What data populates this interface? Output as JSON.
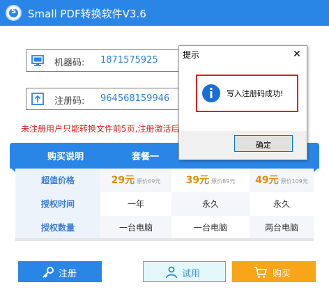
{
  "app": {
    "title": "Small PDF转换软件V3.6",
    "logo_letter": "S",
    "accent_color": "#2a86e6"
  },
  "fields": {
    "machine": {
      "label": "机器码:",
      "value": "1871575925",
      "icon": "monitor-icon"
    },
    "registration": {
      "label": "注册码:",
      "value": "964568159946",
      "icon": "upload-icon"
    }
  },
  "warning": "未注册用户只能转换文件前5页,注册激活后",
  "plans": {
    "header": {
      "desc": "购买说明",
      "plan1": "套餐一"
    },
    "rows": [
      {
        "label": "超值价格",
        "cells": [
          {
            "price": "29元",
            "original": "原价69元"
          },
          {
            "price": "39元",
            "original": "原价89元"
          },
          {
            "price": "49元",
            "original": "原价109元"
          }
        ]
      },
      {
        "label": "授权时间",
        "cells": [
          "一年",
          "永久",
          "永久"
        ]
      },
      {
        "label": "授权数量",
        "cells": [
          "一台电脑",
          "一台电脑",
          "两台电脑"
        ]
      }
    ]
  },
  "buttons": {
    "register": {
      "label": "注册",
      "icon": "key-icon"
    },
    "trial": {
      "label": "试用",
      "icon": "user-icon"
    },
    "buy": {
      "label": "购买",
      "icon": "cart-icon"
    }
  },
  "dialog": {
    "title": "提示",
    "message": "写入注册码成功!",
    "ok_label": "确定",
    "icon": "info-icon"
  }
}
